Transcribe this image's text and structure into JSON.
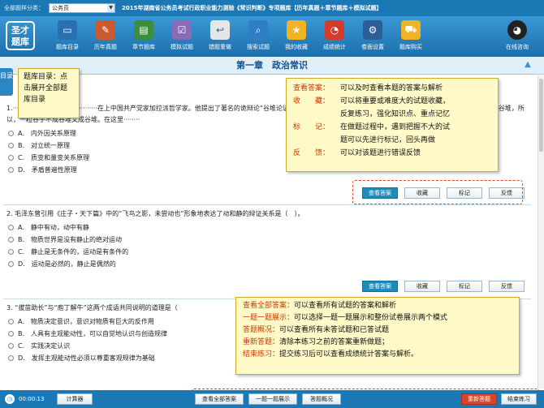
{
  "header": {
    "category_label": "全部题样分类：",
    "category_value": "公务员",
    "title": "2015年湖南省公务员考试行政职业能力测验《常识判断》专项题库【历年真题＋章节题库＋模拟试题】"
  },
  "logo": {
    "line1": "圣才",
    "line2": "题库"
  },
  "toolbar": {
    "items": [
      {
        "name": "question-bank",
        "label": "题库目录",
        "icon": "monitor-icon",
        "color": "#2a6fb0"
      },
      {
        "name": "past-exams",
        "label": "历年真题",
        "icon": "exam-paper-icon",
        "color": "#c95b2f"
      },
      {
        "name": "chapter-bank",
        "label": "章节题库",
        "icon": "book-icon",
        "color": "#3b8e3b"
      },
      {
        "name": "mock-test",
        "label": "模拟试题",
        "icon": "checklist-icon",
        "color": "#8b6bb8"
      },
      {
        "name": "wrong-redo",
        "label": "错题重做",
        "icon": "back-arrow-icon",
        "color": "#e6e6e6"
      },
      {
        "name": "search-questions",
        "label": "搜索试题",
        "icon": "search-icon",
        "color": "#2f7dc2"
      },
      {
        "name": "my-favorites",
        "label": "我的收藏",
        "icon": "star-icon",
        "color": "#f0b323"
      },
      {
        "name": "score-stats",
        "label": "成绩统计",
        "icon": "chart-icon",
        "color": "#d23c2c"
      },
      {
        "name": "page-settings",
        "label": "卷面设置",
        "icon": "gear-icon",
        "color": "#2b5e96"
      },
      {
        "name": "bank-purchase",
        "label": "题库购买",
        "icon": "cart-icon",
        "color": "#f0b323"
      }
    ],
    "online_consult": "在线咨询"
  },
  "chapter_title": "第一章　政治常识",
  "side_tab": "目录",
  "questions": [
    {
      "text": "1.·········································在上中国共产党家加拉派哲学家。他提出了著名的诡辩论“谷堆论证”，即一········································颗谷粒，而每增加的一颗都不能形成谷堆，所以，一粒谷子不成谷堆又成谷堆。在这里········",
      "options": [
        "A.　内外因关系原理",
        "B.　对立统一原理",
        "C.　质变和量变关系原理",
        "D.　矛盾普遍性原理"
      ]
    },
    {
      "text": "2. 毛泽东曾引用《庄子・天下篇》中的“飞鸟之影，未尝动也”形象地表达了动和静的辩证关系是（　）。",
      "options": [
        "A.　静中有动，动中有静",
        "B.　物质世界是没有静止的绝对运动",
        "C.　静止是无条件的，运动是有条件的",
        "D.　运动是必然的，静止是偶然的"
      ]
    },
    {
      "text": "3. “拔苗助长”与“庖丁解牛”这两个成语共同说明的道理是（",
      "options": [
        "A.　物质决定意识，意识对物质有巨大的反作用",
        "B.　人具有主观能动性，可以自觉地认识与创造规律",
        "C.　实践决定认识",
        "D.　发挥主观能动性必须以尊重客观规律为基础"
      ]
    }
  ],
  "question_buttons": {
    "view_answer": "查看答案",
    "favorite": "收藏",
    "mark": "标记",
    "feedback": "反馈"
  },
  "callouts": {
    "directory": "题库目录：点击展开全部题库目录",
    "buttons": [
      {
        "key": "查看答案：",
        "desc": "可以及时查看本题的答案与解析"
      },
      {
        "key": "收　　藏：",
        "desc": "可以将重要或难度大的试题收藏，",
        "cont": "反复练习，强化知识点、重点记忆"
      },
      {
        "key": "标　　记：",
        "desc": "在做题过程中，遇到把握不大的试",
        "cont": "题可以先进行标记，回头再做"
      },
      {
        "key": "反　　馈：",
        "desc": "可以对该题进行错误反馈"
      }
    ],
    "bottom": [
      {
        "key": "查看全部答案：",
        "desc": "可以查看所有试题的答案和解析"
      },
      {
        "key": "一题一题展示：",
        "desc": "可以选择一题一题展示和整份试卷展示两个模式"
      },
      {
        "key": "答题概况：",
        "desc": "可以查看所有未答试题和已答试题"
      },
      {
        "key": "重新答题：",
        "desc": "清除本练习之前的答案重新做题；"
      },
      {
        "key": "结束练习：",
        "desc": "提交练习后可以查看成绩统计答案与解析。"
      }
    ]
  },
  "statusbar": {
    "timer": "00:00:13",
    "calculator": "计算器",
    "view_all_answers": "查看全部答案",
    "one_by_one": "一题一题展示",
    "overview": "答题概况",
    "redo": "重新答题",
    "finish": "结束练习"
  },
  "colors": {
    "primary_blue": "#1b78b4",
    "callout_bg": "#fff9c8",
    "highlight_key": "#c93a00",
    "dashed_border": "#e3462d"
  }
}
